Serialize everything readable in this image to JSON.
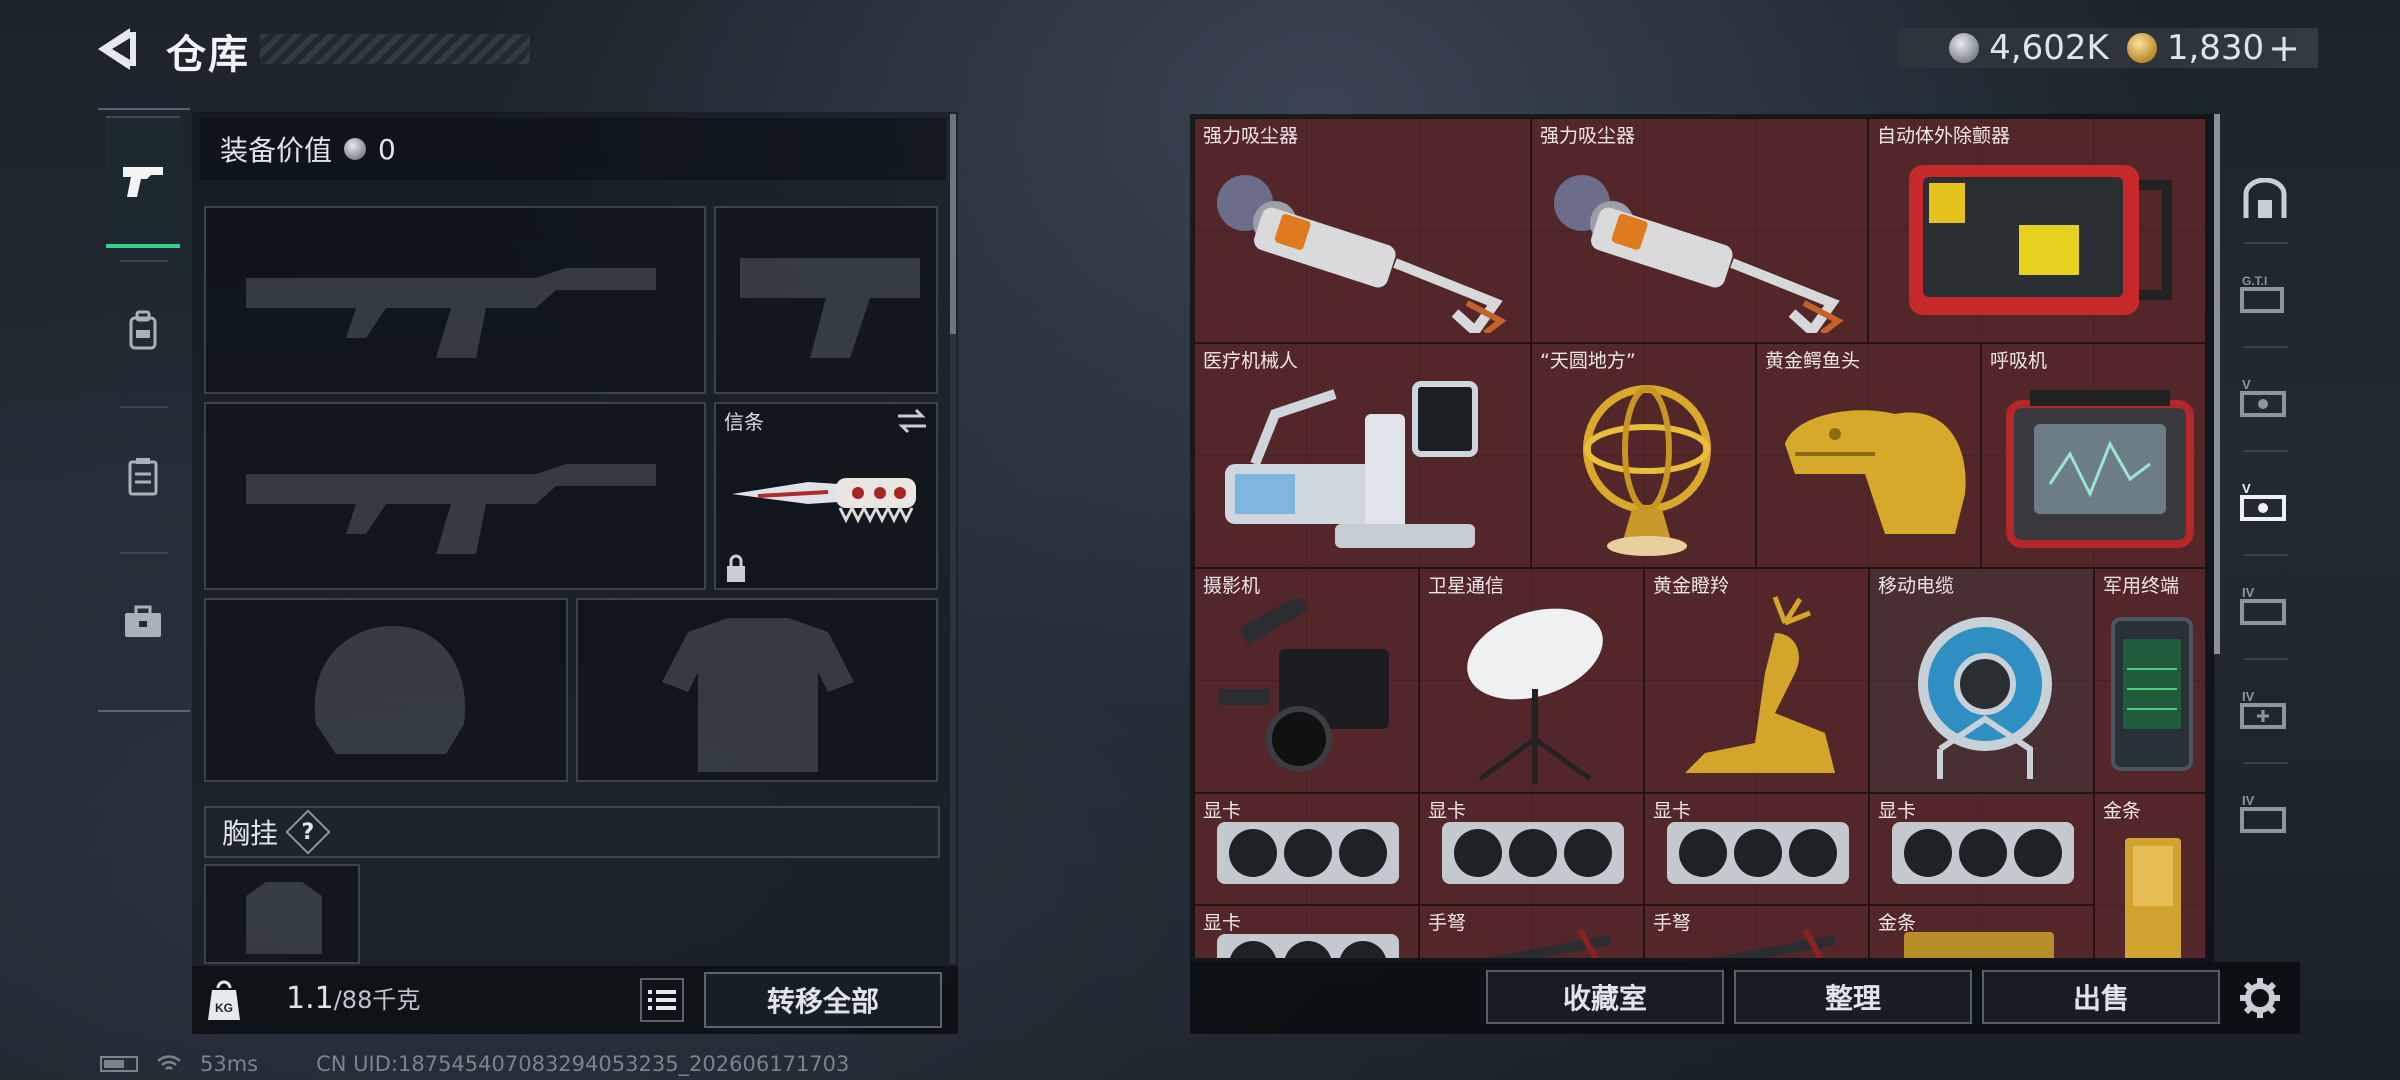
{
  "header": {
    "title": "仓库"
  },
  "currency": {
    "silver": "4,602K",
    "gold": "1,830",
    "plus": "+"
  },
  "loadout": {
    "value_label": "装备价值",
    "value": "0",
    "knife_label": "信条",
    "chest_label": "胸挂",
    "help": "?"
  },
  "weight": {
    "current": "1.1",
    "max": "/88千克"
  },
  "actions": {
    "transfer_all": "转移全部",
    "collection": "收藏室",
    "organize": "整理",
    "sell": "出售"
  },
  "status": {
    "ping": "53ms",
    "uid": "CN UID:18754540708329405323​5_202606171703"
  },
  "stash_items": [
    {
      "name": "强力吸尘器",
      "art": "vacuum"
    },
    {
      "name": "强力吸尘器",
      "art": "vacuum"
    },
    {
      "name": "自动体外除颤器",
      "art": "defib"
    },
    {
      "name": "医疗机械人",
      "art": "robot"
    },
    {
      "name": "“天圆地方”",
      "art": "armillary"
    },
    {
      "name": "黄金鳄鱼头",
      "art": "croc"
    },
    {
      "name": "呼吸机",
      "art": "ventilator"
    },
    {
      "name": "摄影机",
      "art": "camera"
    },
    {
      "name": "卫星通信",
      "art": "dish"
    },
    {
      "name": "黄金瞪羚",
      "art": "deer"
    },
    {
      "name": "移动电缆",
      "art": "reel"
    },
    {
      "name": "军用终端",
      "art": "terminal"
    },
    {
      "name": "显卡",
      "art": "gpu"
    },
    {
      "name": "显卡",
      "art": "gpu"
    },
    {
      "name": "显卡",
      "art": "gpu"
    },
    {
      "name": "显卡",
      "art": "gpu"
    },
    {
      "name": "金条",
      "art": "goldbar"
    },
    {
      "name": "显卡",
      "art": "gpu"
    },
    {
      "name": "手弩",
      "art": "crossbow"
    },
    {
      "name": "手弩",
      "art": "crossbow"
    },
    {
      "name": "金条",
      "art": "goldbar"
    }
  ]
}
